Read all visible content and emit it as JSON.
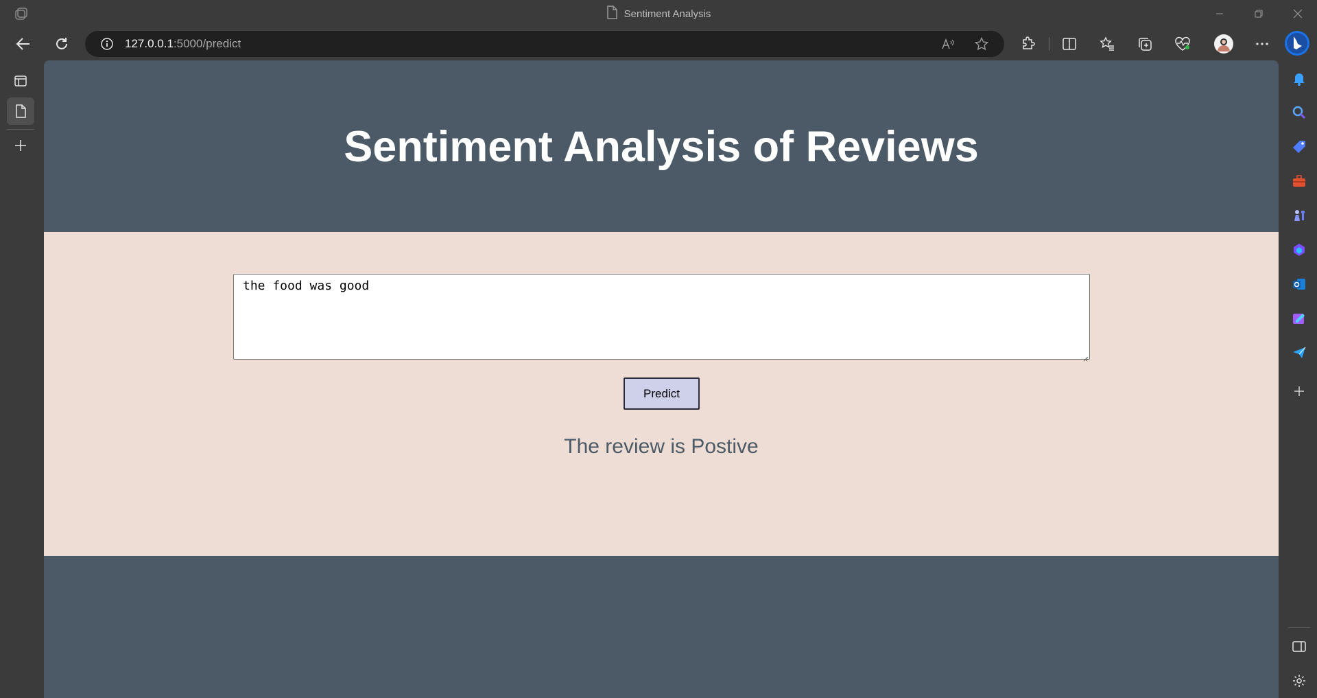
{
  "browser": {
    "window_title": "Sentiment Analysis",
    "url_host": "127.0.0.1",
    "url_path": ":5000/predict"
  },
  "page": {
    "heading": "Sentiment Analysis of Reviews",
    "review_text": "the food was good",
    "predict_label": "Predict",
    "result_text": "The review is Postive"
  },
  "colors": {
    "header_bg": "#4b5a66",
    "main_bg": "#eeddd4",
    "button_bg": "#cfd0ea",
    "result_color": "#4b5a66"
  }
}
